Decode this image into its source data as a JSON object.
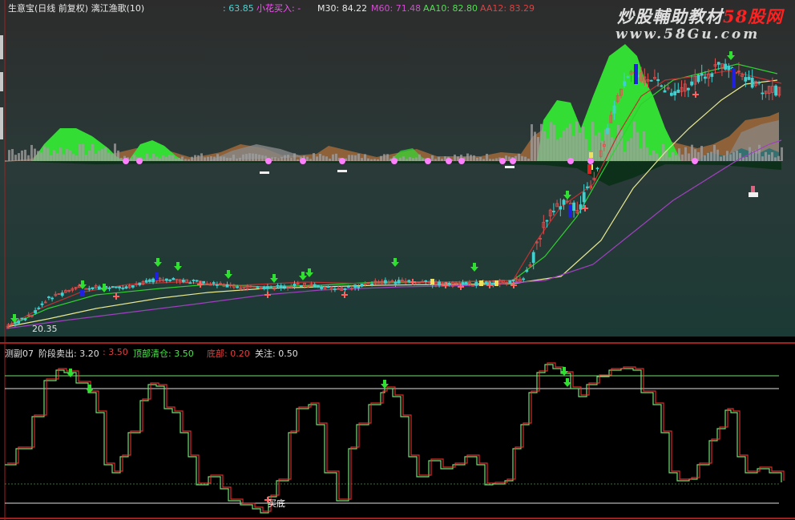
{
  "header": {
    "indicator_name": "生意宝(日线 前复权) 漓江渔歌(10)",
    "price_readout": ": 63.85",
    "signal_label": "小花买入: -",
    "ma30": "M30: 84.22",
    "ma60": "M60: 71.48",
    "aa10": "AA10: 82.80",
    "aa12": "AA12: 83.29"
  },
  "watermark": {
    "line1_a": "炒股輔助教材",
    "line1_b": "58股网",
    "line2": "www.58Gu.com"
  },
  "main_panel": {
    "low_price_label": "20.35"
  },
  "sub_panel": {
    "name": "测副07",
    "stage_sell": "阶段卖出: 3.20",
    "value2": ": 3.50",
    "top_clear": "顶部清仓: 3.50",
    "bottom": "底部: 0.20",
    "watch": "关注: 0.50",
    "buy_bottom_label": "买底"
  },
  "colors": {
    "background_top": "#2e2e2e",
    "background_bottom": "#1e3d38",
    "candle_up": "#e05050",
    "candle_down": "#40d0d0",
    "mountain_green": "#33dd33",
    "mountain_brown": "#a06838",
    "ma_yellow": "#e8e890",
    "ma_green": "#30d030",
    "ma_purple": "#a040c0",
    "ma_red": "#d02020",
    "pink_dot": "#ff80ff",
    "osc_green": "#70e070",
    "osc_red": "#ff3030"
  }
}
